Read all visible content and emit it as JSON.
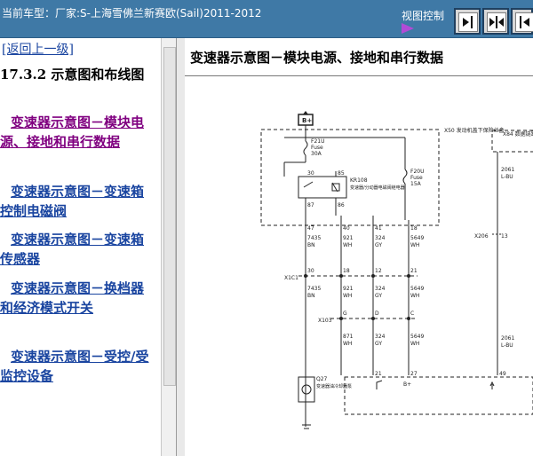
{
  "header": {
    "car_title": "当前车型：厂家:S-上海雪佛兰新赛欧(Sail)2011-2012",
    "view_control_label": "视图控制",
    "buttons": [
      {
        "name": "collapse-sidebar-button",
        "icon": "arrow-to-bar-icon"
      },
      {
        "name": "restore-split-button",
        "icon": "split-arrows-icon"
      },
      {
        "name": "expand-sidebar-button",
        "icon": "arrow-from-bar-icon"
      }
    ]
  },
  "sidebar": {
    "back_link": "[返回上一级]",
    "section_title": "17.3.2 示意图和布线图",
    "items": [
      {
        "label": "变速器示意图－模块电源、接地和串行数据",
        "visited": true
      },
      {
        "label": "变速器示意图－变速箱控制电磁阀",
        "visited": false
      },
      {
        "label": "变速器示意图－变速箱传感器",
        "visited": false
      },
      {
        "label": "变速器示意图－换档器和经济模式开关",
        "visited": false
      },
      {
        "label": "变速器示意图－受控/受监控设备",
        "visited": false
      }
    ]
  },
  "colors": {
    "header_bg": "#3f79a6",
    "link": "#1a45a0",
    "visited_link": "#800080"
  },
  "diagram": {
    "title": "变速器示意图－模块电源、接地和串行数据",
    "battery_label": "B+",
    "fuse_box_label": "X50 发动机盖下保险丝盒",
    "right_box_label": "X84 数据链路连接器",
    "fuses": [
      {
        "name": "F21U",
        "type": "Fuse",
        "rating": "30A"
      },
      {
        "name": "F20U",
        "type": "Fuse",
        "rating": "15A"
      }
    ],
    "relay": {
      "name": "KR108",
      "desc": "变速器/分动器电磁阀继电器",
      "pins": [
        "30",
        "85",
        "87",
        "86"
      ]
    },
    "splice_x206": "X206",
    "splice_x206_pin": "13",
    "right_wire": {
      "circuit": "2061",
      "color": "L-BU"
    },
    "right_wire_lower": {
      "circuit": "2061",
      "color": "L-BU"
    },
    "top_wires": [
      {
        "pin": "47",
        "circuit": "7435",
        "color": "BN"
      },
      {
        "pin": "40",
        "circuit": "921",
        "color": "WH"
      },
      {
        "pin": "41",
        "circuit": "324",
        "color": "GY"
      },
      {
        "pin": "18",
        "circuit": "5649",
        "color": "WH"
      }
    ],
    "connector_x1c1": "X1C1",
    "x1c1_pins": [
      "30",
      "18",
      "12",
      "21"
    ],
    "mid_wires": [
      {
        "circuit": "7435",
        "color": "BN"
      },
      {
        "circuit": "921",
        "color": "WH"
      },
      {
        "circuit": "324",
        "color": "GY"
      },
      {
        "circuit": "5649",
        "color": "WH"
      }
    ],
    "connector_x103": "X103",
    "x103_pins": [
      "G",
      "D",
      "C"
    ],
    "low_wires": [
      {
        "circuit": "871",
        "color": "WH"
      },
      {
        "circuit": "324",
        "color": "GY"
      },
      {
        "circuit": "5649",
        "color": "WH"
      }
    ],
    "module_pins": [
      "21",
      "27",
      "49"
    ],
    "module_bplus": "B+",
    "ground_device": {
      "name": "Q27",
      "desc": "变速器油冷却器泵"
    }
  }
}
